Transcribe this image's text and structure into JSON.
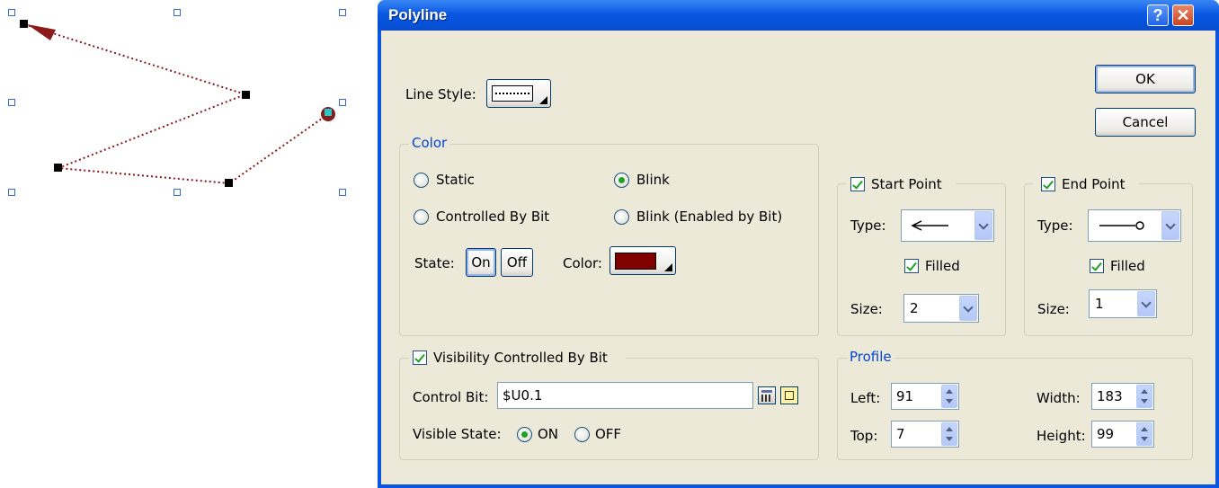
{
  "dialog": {
    "title": "Polyline",
    "help_glyph": "?",
    "close_glyph": "✕",
    "ok_label": "OK",
    "cancel_label": "Cancel"
  },
  "line_style": {
    "label": "Line Style:",
    "style": "dotted"
  },
  "color_group": {
    "legend": "Color",
    "options": {
      "static": "Static",
      "blink": "Blink",
      "controlled_by_bit": "Controlled By Bit",
      "blink_enabled_by_bit": "Blink (Enabled by Bit)"
    },
    "selected": "Blink",
    "state_label": "State:",
    "state_on": "On",
    "state_off": "Off",
    "color_label": "Color:",
    "color_value": "#800000"
  },
  "visibility": {
    "legend": "Visibility Controlled By Bit",
    "checked": true,
    "control_bit_label": "Control Bit:",
    "control_bit_value": "$U0.1",
    "visible_state_label": "Visible State:",
    "on_label": "ON",
    "off_label": "OFF",
    "selected": "ON"
  },
  "start_point": {
    "legend": "Start Point",
    "checked": true,
    "type_label": "Type:",
    "type_icon": "arrow-left-icon",
    "filled_label": "Filled",
    "filled": true,
    "size_label": "Size:",
    "size_value": "2"
  },
  "end_point": {
    "legend": "End Point",
    "checked": true,
    "type_label": "Type:",
    "type_icon": "circle-end-icon",
    "filled_label": "Filled",
    "filled": true,
    "size_label": "Size:",
    "size_value": "1"
  },
  "profile": {
    "legend": "Profile",
    "left_label": "Left:",
    "left_value": "91",
    "top_label": "Top:",
    "top_value": "7",
    "width_label": "Width:",
    "width_value": "183",
    "height_label": "Height:",
    "height_value": "99"
  },
  "colors": {
    "title_bar": "#0a58e2",
    "dialog_bg": "#ece9d8",
    "line_color": "#800000",
    "group_legend": "#0046d5"
  }
}
